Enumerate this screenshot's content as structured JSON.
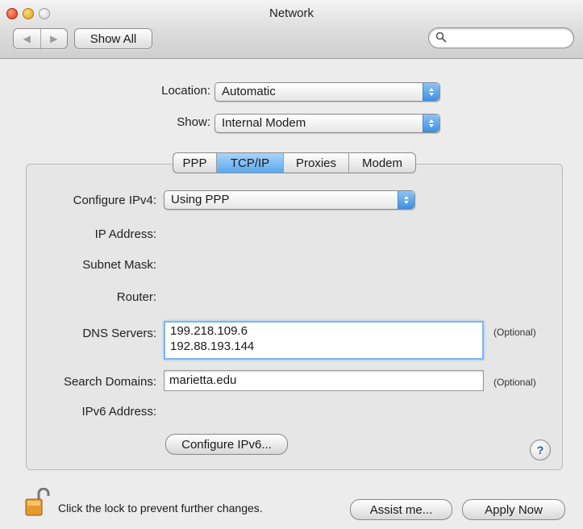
{
  "window": {
    "title": "Network"
  },
  "toolbar": {
    "back_icon": "back-arrow-icon",
    "forward_icon": "forward-arrow-icon",
    "show_all_label": "Show All",
    "search_placeholder": ""
  },
  "location": {
    "label": "Location:",
    "value": "Automatic"
  },
  "show": {
    "label": "Show:",
    "value": "Internal Modem"
  },
  "tabs": [
    {
      "label": "PPP",
      "active": false
    },
    {
      "label": "TCP/IP",
      "active": true
    },
    {
      "label": "Proxies",
      "active": false
    },
    {
      "label": "Modem",
      "active": false
    }
  ],
  "tcpip": {
    "configure_ipv4": {
      "label": "Configure IPv4:",
      "value": "Using PPP"
    },
    "ip_address": {
      "label": "IP Address:",
      "value": ""
    },
    "subnet_mask": {
      "label": "Subnet Mask:",
      "value": ""
    },
    "router": {
      "label": "Router:",
      "value": ""
    },
    "dns_servers": {
      "label": "DNS Servers:",
      "lines": [
        "199.218.109.6",
        "192.88.193.144"
      ],
      "hint": "(Optional)"
    },
    "search_domains": {
      "label": "Search Domains:",
      "value": "marietta.edu",
      "hint": "(Optional)"
    },
    "ipv6_address": {
      "label": "IPv6 Address:",
      "value": ""
    },
    "configure_ipv6_label": "Configure IPv6...",
    "help_label": "?"
  },
  "footer": {
    "lock_text": "Click the lock to prevent further changes.",
    "assist_label": "Assist me...",
    "apply_label": "Apply Now"
  },
  "colors": {
    "accent": "#5aa9ee",
    "window_bg": "#ececec"
  }
}
